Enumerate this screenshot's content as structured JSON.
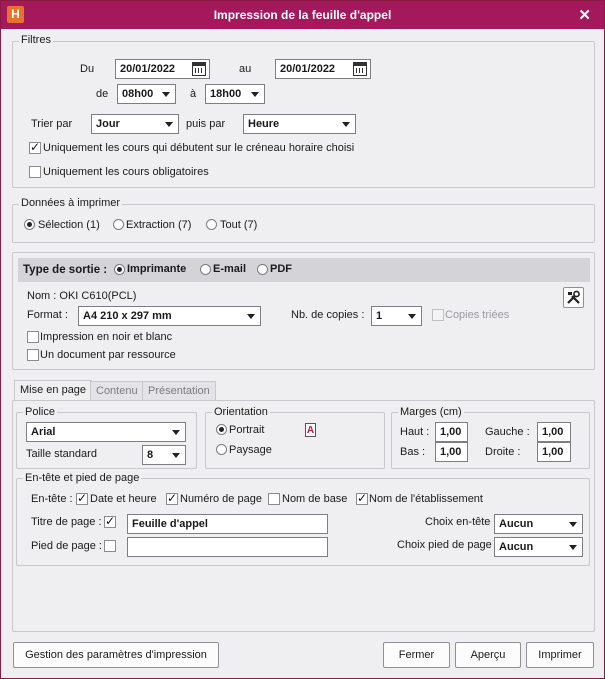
{
  "window": {
    "title": "Impression de la feuille d'appel",
    "close": "✕",
    "logo": "H"
  },
  "filtres": {
    "legend": "Filtres",
    "du_label": "Du",
    "du_value": "20/01/2022",
    "au_label": "au",
    "au_value": "20/01/2022",
    "de_label": "de",
    "de_value": "08h00",
    "a_label": "à",
    "a_value": "18h00",
    "trier_label": "Trier par",
    "trier_value": "Jour",
    "puis_label": "puis par",
    "puis_value": "Heure",
    "check1": "Uniquement les cours qui débutent sur le créneau horaire choisi",
    "check2": "Uniquement les cours obligatoires"
  },
  "donnees": {
    "legend": "Données à imprimer",
    "opt1": "Sélection (1)",
    "opt2": "Extraction (7)",
    "opt3": "Tout (7)"
  },
  "sortie": {
    "label": "Type de sortie :",
    "opt1": "Imprimante",
    "opt2": "E-mail",
    "opt3": "PDF",
    "nom": "Nom : OKI C610(PCL)",
    "format_label": "Format :",
    "format_value": "A4 210 x 297 mm",
    "copies_label": "Nb. de copies :",
    "copies_value": "1",
    "copies_triees": "Copies triées",
    "check_noir": "Impression en noir et blanc",
    "check_doc": "Un document par ressource"
  },
  "tabs": [
    {
      "label": "Mise en page"
    },
    {
      "label": "Contenu"
    },
    {
      "label": "Présentation"
    }
  ],
  "police": {
    "legend": "Police",
    "font_value": "Arial",
    "taille_label": "Taille standard",
    "taille_value": "8"
  },
  "orientation": {
    "legend": "Orientation",
    "portrait": "Portrait",
    "paysage": "Paysage",
    "icon_glyph": "A"
  },
  "marges": {
    "legend": "Marges (cm)",
    "haut_label": "Haut :",
    "haut_value": "1,00",
    "gauche_label": "Gauche :",
    "gauche_value": "1,00",
    "bas_label": "Bas :",
    "bas_value": "1,00",
    "droite_label": "Droite :",
    "droite_value": "1,00"
  },
  "entete": {
    "legend": "En-tête et pied de page",
    "label": "En-tête :",
    "c1": "Date et heure",
    "c2": "Numéro de page",
    "c3": "Nom de base",
    "c4": "Nom de l'établissement",
    "titre_label": "Titre de page :",
    "titre_value": "Feuille d'appel",
    "pied_label": "Pied de page :",
    "pied_value": "",
    "choix_entete_label": "Choix en-tête",
    "choix_entete_value": "Aucun",
    "choix_pied_label": "Choix pied de page",
    "choix_pied_value": "Aucun"
  },
  "buttons": {
    "gestion": "Gestion des paramètres d'impression",
    "fermer": "Fermer",
    "apercu": "Aperçu",
    "imprimer": "Imprimer"
  }
}
